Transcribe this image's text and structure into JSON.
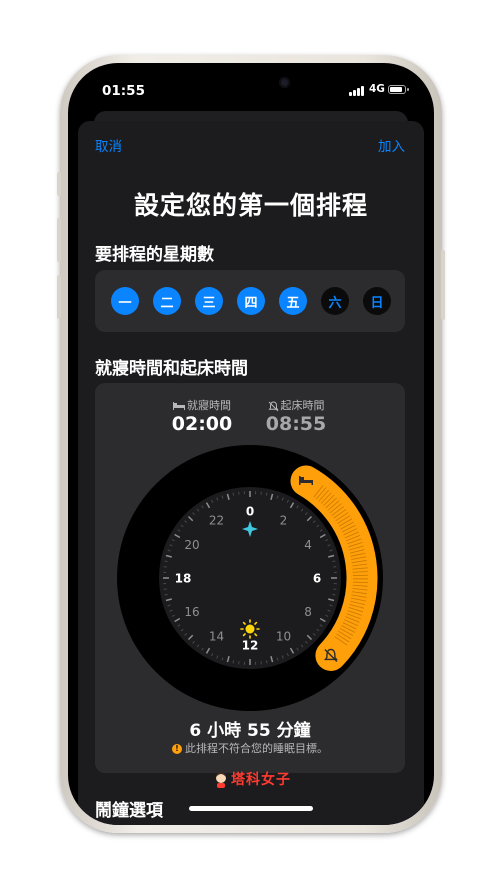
{
  "status": {
    "time": "01:55",
    "network": "4G"
  },
  "nav": {
    "cancel": "取消",
    "add": "加入"
  },
  "title": "設定您的第一個排程",
  "days_section": {
    "label": "要排程的星期數",
    "days": [
      {
        "label": "一",
        "selected": true
      },
      {
        "label": "二",
        "selected": true
      },
      {
        "label": "三",
        "selected": true
      },
      {
        "label": "四",
        "selected": true
      },
      {
        "label": "五",
        "selected": true
      },
      {
        "label": "六",
        "selected": false
      },
      {
        "label": "日",
        "selected": false
      }
    ]
  },
  "times_section": {
    "label": "就寢時間和起床時間",
    "bedtime": {
      "label": "就寢時間",
      "value": "02:00",
      "icon": "bed-icon"
    },
    "wakeup": {
      "label": "起床時間",
      "value": "08:55",
      "icon": "alarm-bell-icon"
    },
    "clock": {
      "hour_labels": [
        "0",
        "2",
        "4",
        "6",
        "8",
        "10",
        "12",
        "14",
        "16",
        "18",
        "20",
        "22"
      ],
      "bedtime_hours": 2.0,
      "wakeup_hours": 8.9167,
      "accent": "#ff9f0a"
    },
    "duration": "6 小時 55 分鐘",
    "warning": "此排程不符合您的睡眠目標。"
  },
  "watermark": "塔科女子",
  "alarm_section": {
    "label": "鬧鐘選項"
  },
  "colors": {
    "accent_blue": "#0a84ff",
    "accent_orange": "#ff9f0a",
    "card": "#2c2c2e",
    "sheet": "#1c1c1e"
  }
}
